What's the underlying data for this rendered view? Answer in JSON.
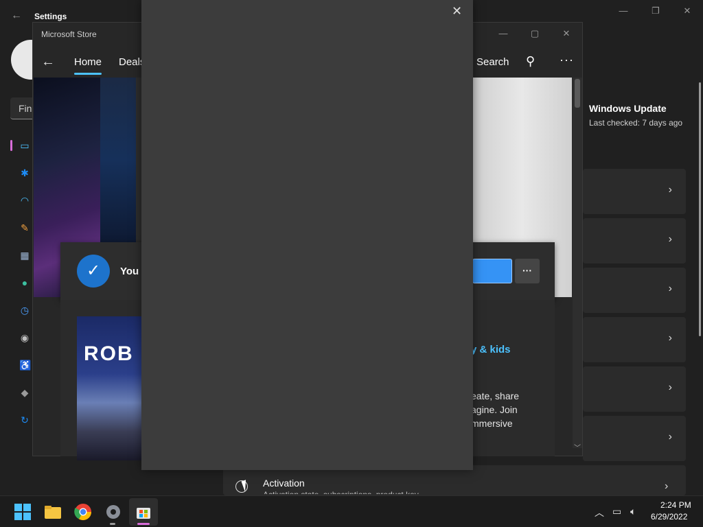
{
  "settings": {
    "title": "Settings",
    "find_placeholder": "Find",
    "windows_update": {
      "title": "Windows Update",
      "subtitle": "Last checked: 7 days ago"
    },
    "activation": {
      "label": "Activation",
      "subtitle": "Activation state, subscriptions, product key"
    }
  },
  "store": {
    "title": "Microsoft Store",
    "tabs": {
      "home": "Home",
      "deals": "Deals"
    },
    "search": "Search",
    "banner": {
      "text": "You c"
    },
    "game": {
      "logo_text": "ROB"
    },
    "category_link": "y & kids",
    "description": [
      "eate, share",
      "agine. Join",
      "mmersive"
    ]
  },
  "dialog": {
    "close": "✕"
  },
  "taskbar": {
    "time": "2:24 PM",
    "date": "6/29/2022"
  },
  "colors": {
    "accent": "#4cc2ff",
    "banner_check": "#1d73cc",
    "button": "#3593f5"
  }
}
